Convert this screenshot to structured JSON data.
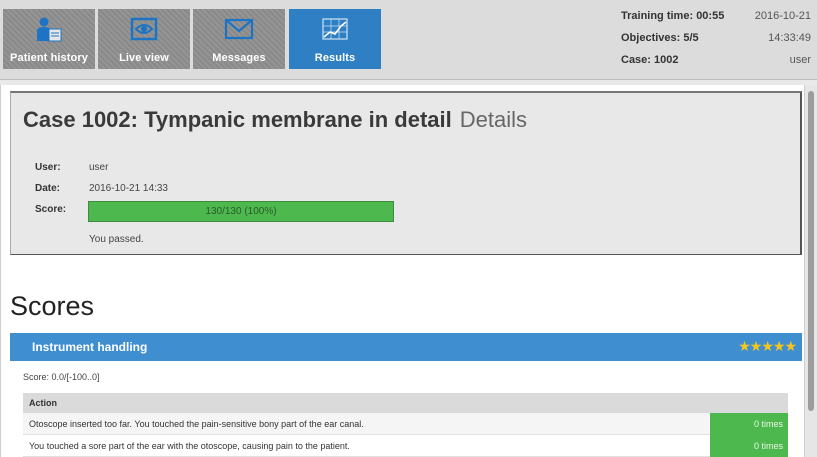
{
  "tabs": [
    {
      "label": "Patient history",
      "icon": "patient-history-icon"
    },
    {
      "label": "Live view",
      "icon": "eye-icon"
    },
    {
      "label": "Messages",
      "icon": "envelope-icon"
    },
    {
      "label": "Results",
      "icon": "chart-icon"
    }
  ],
  "status": {
    "training_time_label": "Training time:",
    "training_time_value": "00:55",
    "date": "2016-10-21",
    "objectives_label": "Objectives:",
    "objectives_value": "5/5",
    "time": "14:33:49",
    "case_label": "Case:",
    "case_value": "1002",
    "user": "user"
  },
  "case": {
    "title": "Case 1002: Tympanic membrane in detail",
    "subtitle": "Details",
    "user_label": "User:",
    "user_value": "user",
    "date_label": "Date:",
    "date_value": "2016-10-21 14:33",
    "score_label": "Score:",
    "score_text": "130/130 (100%)",
    "score_fraction": 1.0,
    "result": "You passed."
  },
  "scores": {
    "heading": "Scores",
    "sections": [
      {
        "title": "Instrument handling",
        "stars": "★★★★★",
        "score_line": "Score: 0.0/[-100..0]",
        "column_header": "Action",
        "rows": [
          {
            "text": "Otoscope inserted too far. You touched the pain-sensitive bony part of the ear canal.",
            "count": "0 times"
          },
          {
            "text": "You touched a sore part of the ear with the otoscope, causing pain to the patient.",
            "count": "0 times"
          }
        ]
      }
    ]
  },
  "colors": {
    "active_tab": "#2e7fc4",
    "inactive_tab": "#8f8f8f",
    "section_bar": "#3f8fd0",
    "success_green": "#4db84d",
    "star_gold": "#f7c61a"
  }
}
